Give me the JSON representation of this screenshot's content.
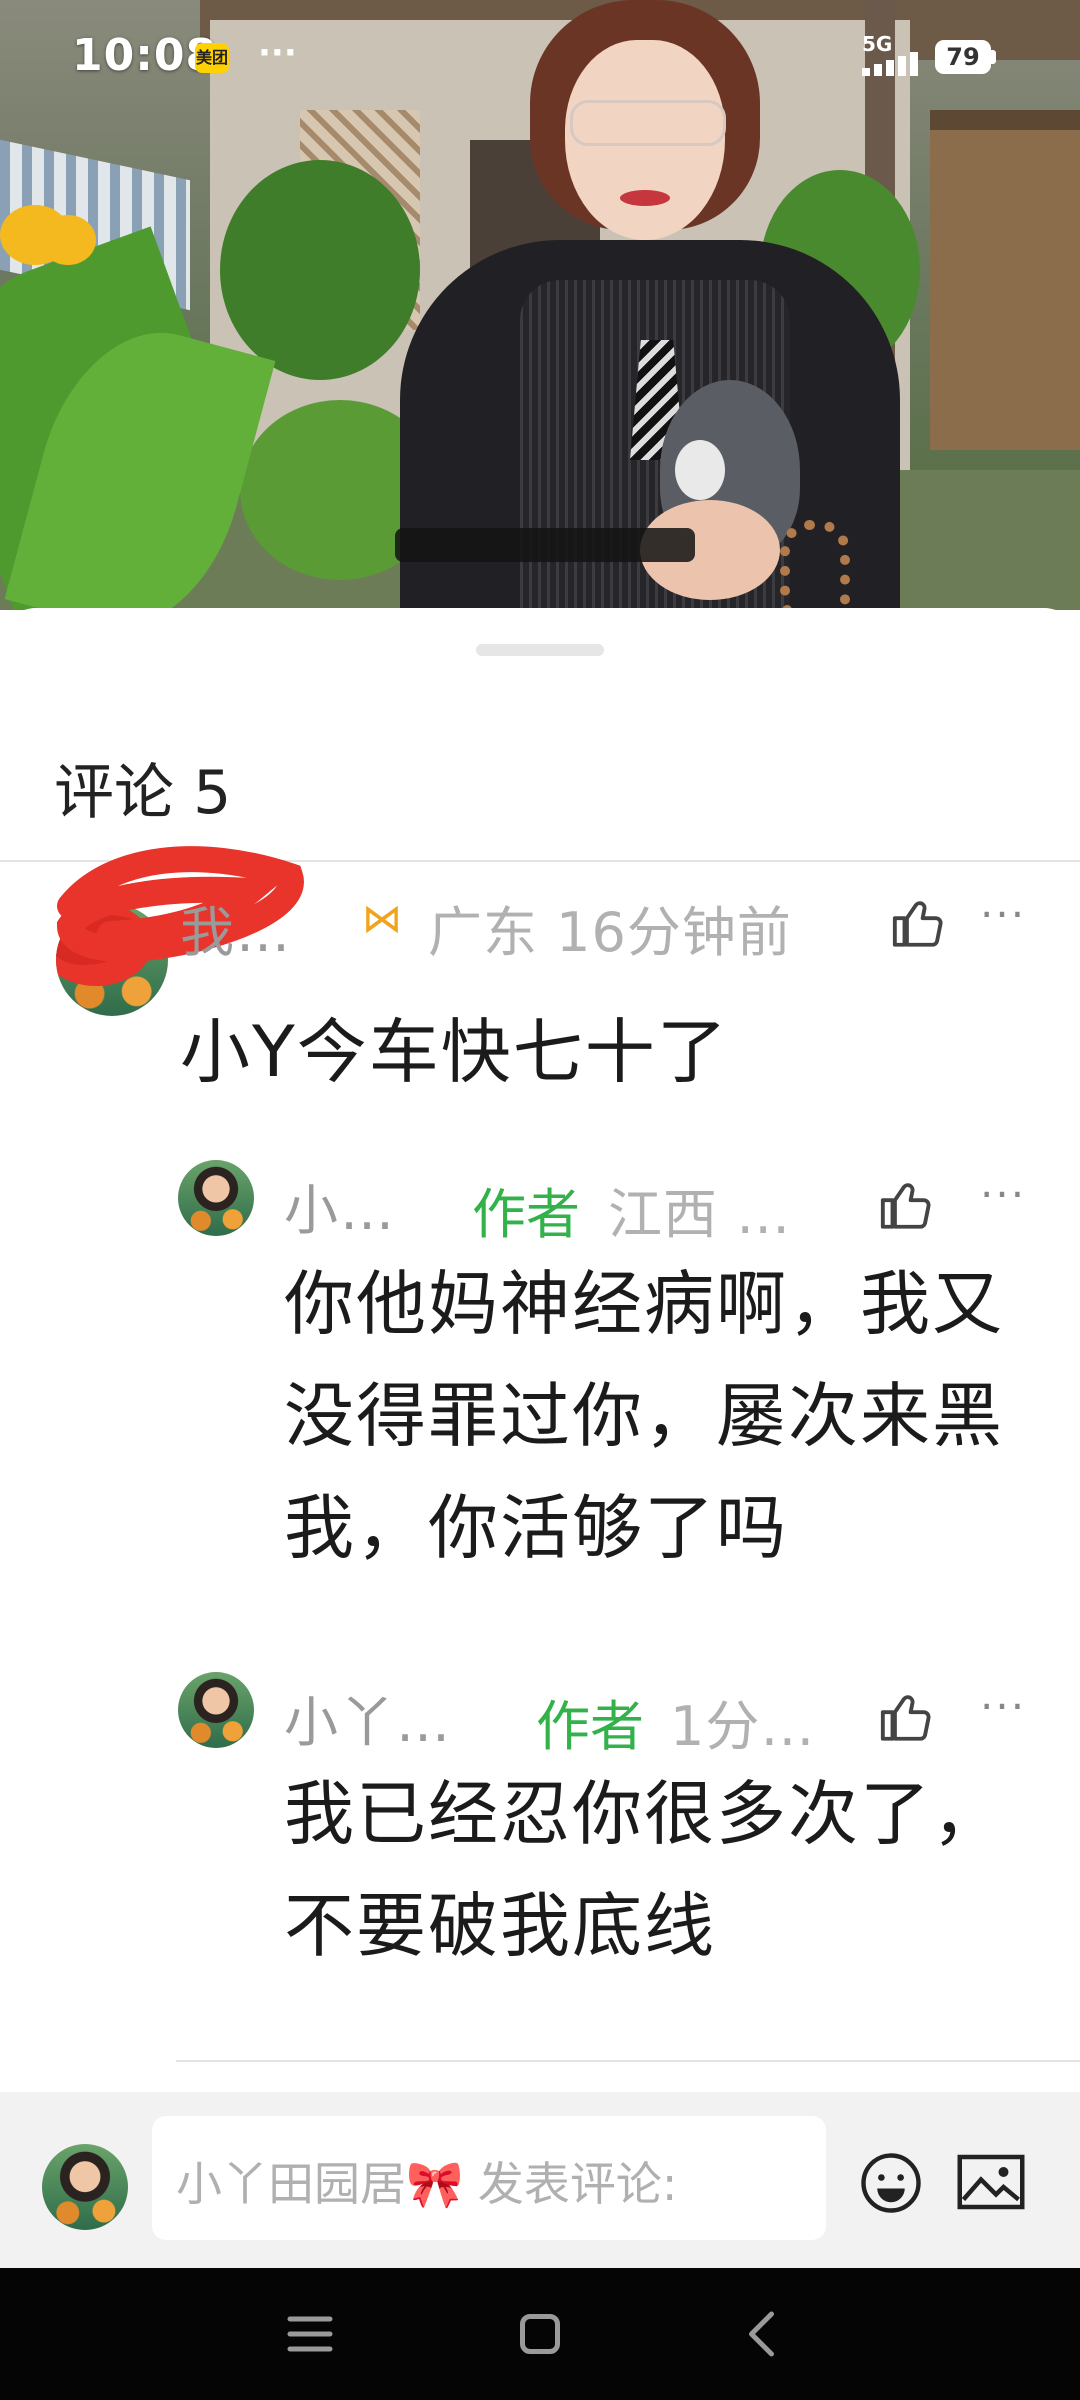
{
  "status_bar": {
    "time": "10:08",
    "app_badge": "美团",
    "dots": "···",
    "network": "5G",
    "battery": "79"
  },
  "sheet": {
    "title": "评论 5"
  },
  "comments": [
    {
      "name": "我…",
      "badge_icon": "ribbon-badge-icon",
      "meta": "广东 16分钟前",
      "text": "小Y今车快七十了"
    }
  ],
  "replies": [
    {
      "name": "小…",
      "author_tag": "作者",
      "meta": "江西 …",
      "text": "你他妈神经病啊，我又没得罪过你，屡次来黑我，你活够了吗"
    },
    {
      "name": "小丫…",
      "author_tag": "作者",
      "meta": "1分…",
      "text": "我已经忍你很多次了，不要破我底线"
    }
  ],
  "input_bar": {
    "placeholder": "小丫田园居🎀 发表评论:"
  },
  "colors": {
    "author_green": "#33b24a",
    "meta_gray": "#b1b1b1",
    "badge_gold": "#f0a41e",
    "redaction_red": "#e8342a"
  }
}
